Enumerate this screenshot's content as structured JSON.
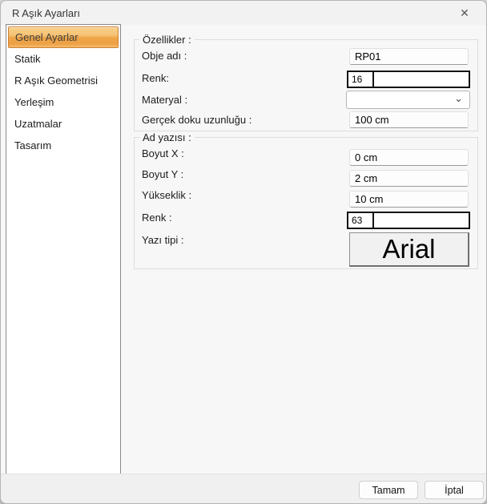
{
  "window": {
    "title": "R Aşık Ayarları",
    "close_icon": "✕"
  },
  "sidebar": {
    "items": [
      {
        "label": "Genel Ayarlar",
        "selected": true
      },
      {
        "label": "Statik",
        "selected": false
      },
      {
        "label": "R Aşık Geometrisi",
        "selected": false
      },
      {
        "label": "Yerleşim",
        "selected": false
      },
      {
        "label": "Uzatmalar",
        "selected": false
      },
      {
        "label": "Tasarım",
        "selected": false
      }
    ],
    "selected_accent": "#EFA648"
  },
  "groups": {
    "ozellikler": {
      "title": "Özellikler :",
      "obje_adi": {
        "label": "Obje adı :",
        "value": "RP01"
      },
      "renk": {
        "label": "Renk:",
        "value": "16",
        "color": "#939631"
      },
      "materyal": {
        "label": "Materyal :",
        "value": "",
        "chevron": "⌄"
      },
      "doku": {
        "label": "Gerçek doku uzunluğu :",
        "value": "100 cm"
      }
    },
    "ad_yazisi": {
      "title": "Ad yazısı :",
      "boyut_x": {
        "label": "Boyut  X :",
        "value": "0 cm"
      },
      "boyut_y": {
        "label": "Boyut Y :",
        "value": "2 cm"
      },
      "yukseklik": {
        "label": "Yükseklik :",
        "value": "10 cm"
      },
      "renk": {
        "label": "Renk :",
        "value": "63",
        "color": "#1C1C1C"
      },
      "yazi_tipi": {
        "label": "Yazı tipi :",
        "value": "Arial"
      }
    }
  },
  "footer": {
    "ok_label": "Tamam",
    "cancel_label": "İptal"
  }
}
